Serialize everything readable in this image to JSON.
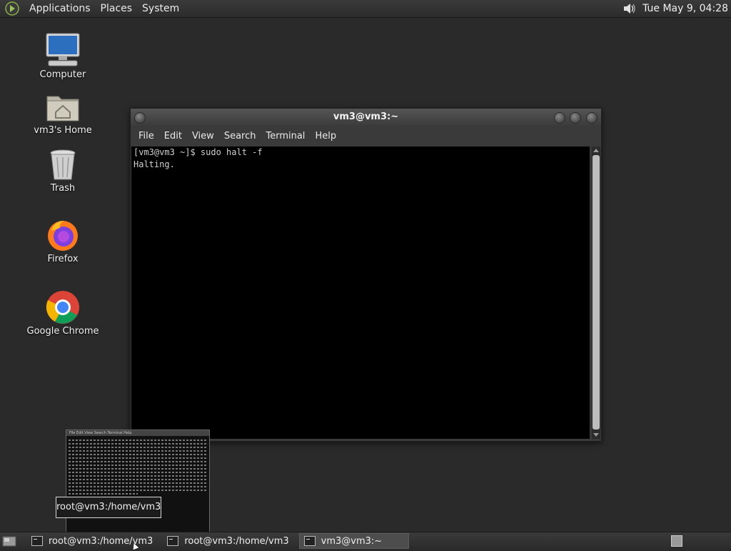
{
  "top_panel": {
    "menus": [
      "Applications",
      "Places",
      "System"
    ],
    "clock": "Tue May  9, 04:28"
  },
  "desktop": {
    "icons": [
      {
        "label": "Computer",
        "icon": "computer-icon"
      },
      {
        "label": "vm3's Home",
        "icon": "home-folder-icon"
      },
      {
        "label": "Trash",
        "icon": "trash-icon"
      },
      {
        "label": "Firefox",
        "icon": "firefox-icon"
      },
      {
        "label": "Google Chrome",
        "icon": "chrome-icon"
      }
    ]
  },
  "terminal_window": {
    "title": "vm3@vm3:~",
    "menu": [
      "File",
      "Edit",
      "View",
      "Search",
      "Terminal",
      "Help"
    ],
    "lines": [
      "[vm3@vm3 ~]$ sudo halt -f",
      "Halting."
    ]
  },
  "preview": {
    "tooltip": "root@vm3:/home/vm3",
    "menu": "File  Edit  View  Search  Terminal  Help"
  },
  "taskbar": {
    "tasks": [
      {
        "label": "root@vm3:/home/vm3",
        "active": false
      },
      {
        "label": "root@vm3:/home/vm3",
        "active": false
      },
      {
        "label": "vm3@vm3:~",
        "active": true
      }
    ]
  },
  "colors": {
    "desktop_bg": "#2a2a2a",
    "terminal_bg": "#000000",
    "terminal_fg": "#cfcfcf"
  }
}
